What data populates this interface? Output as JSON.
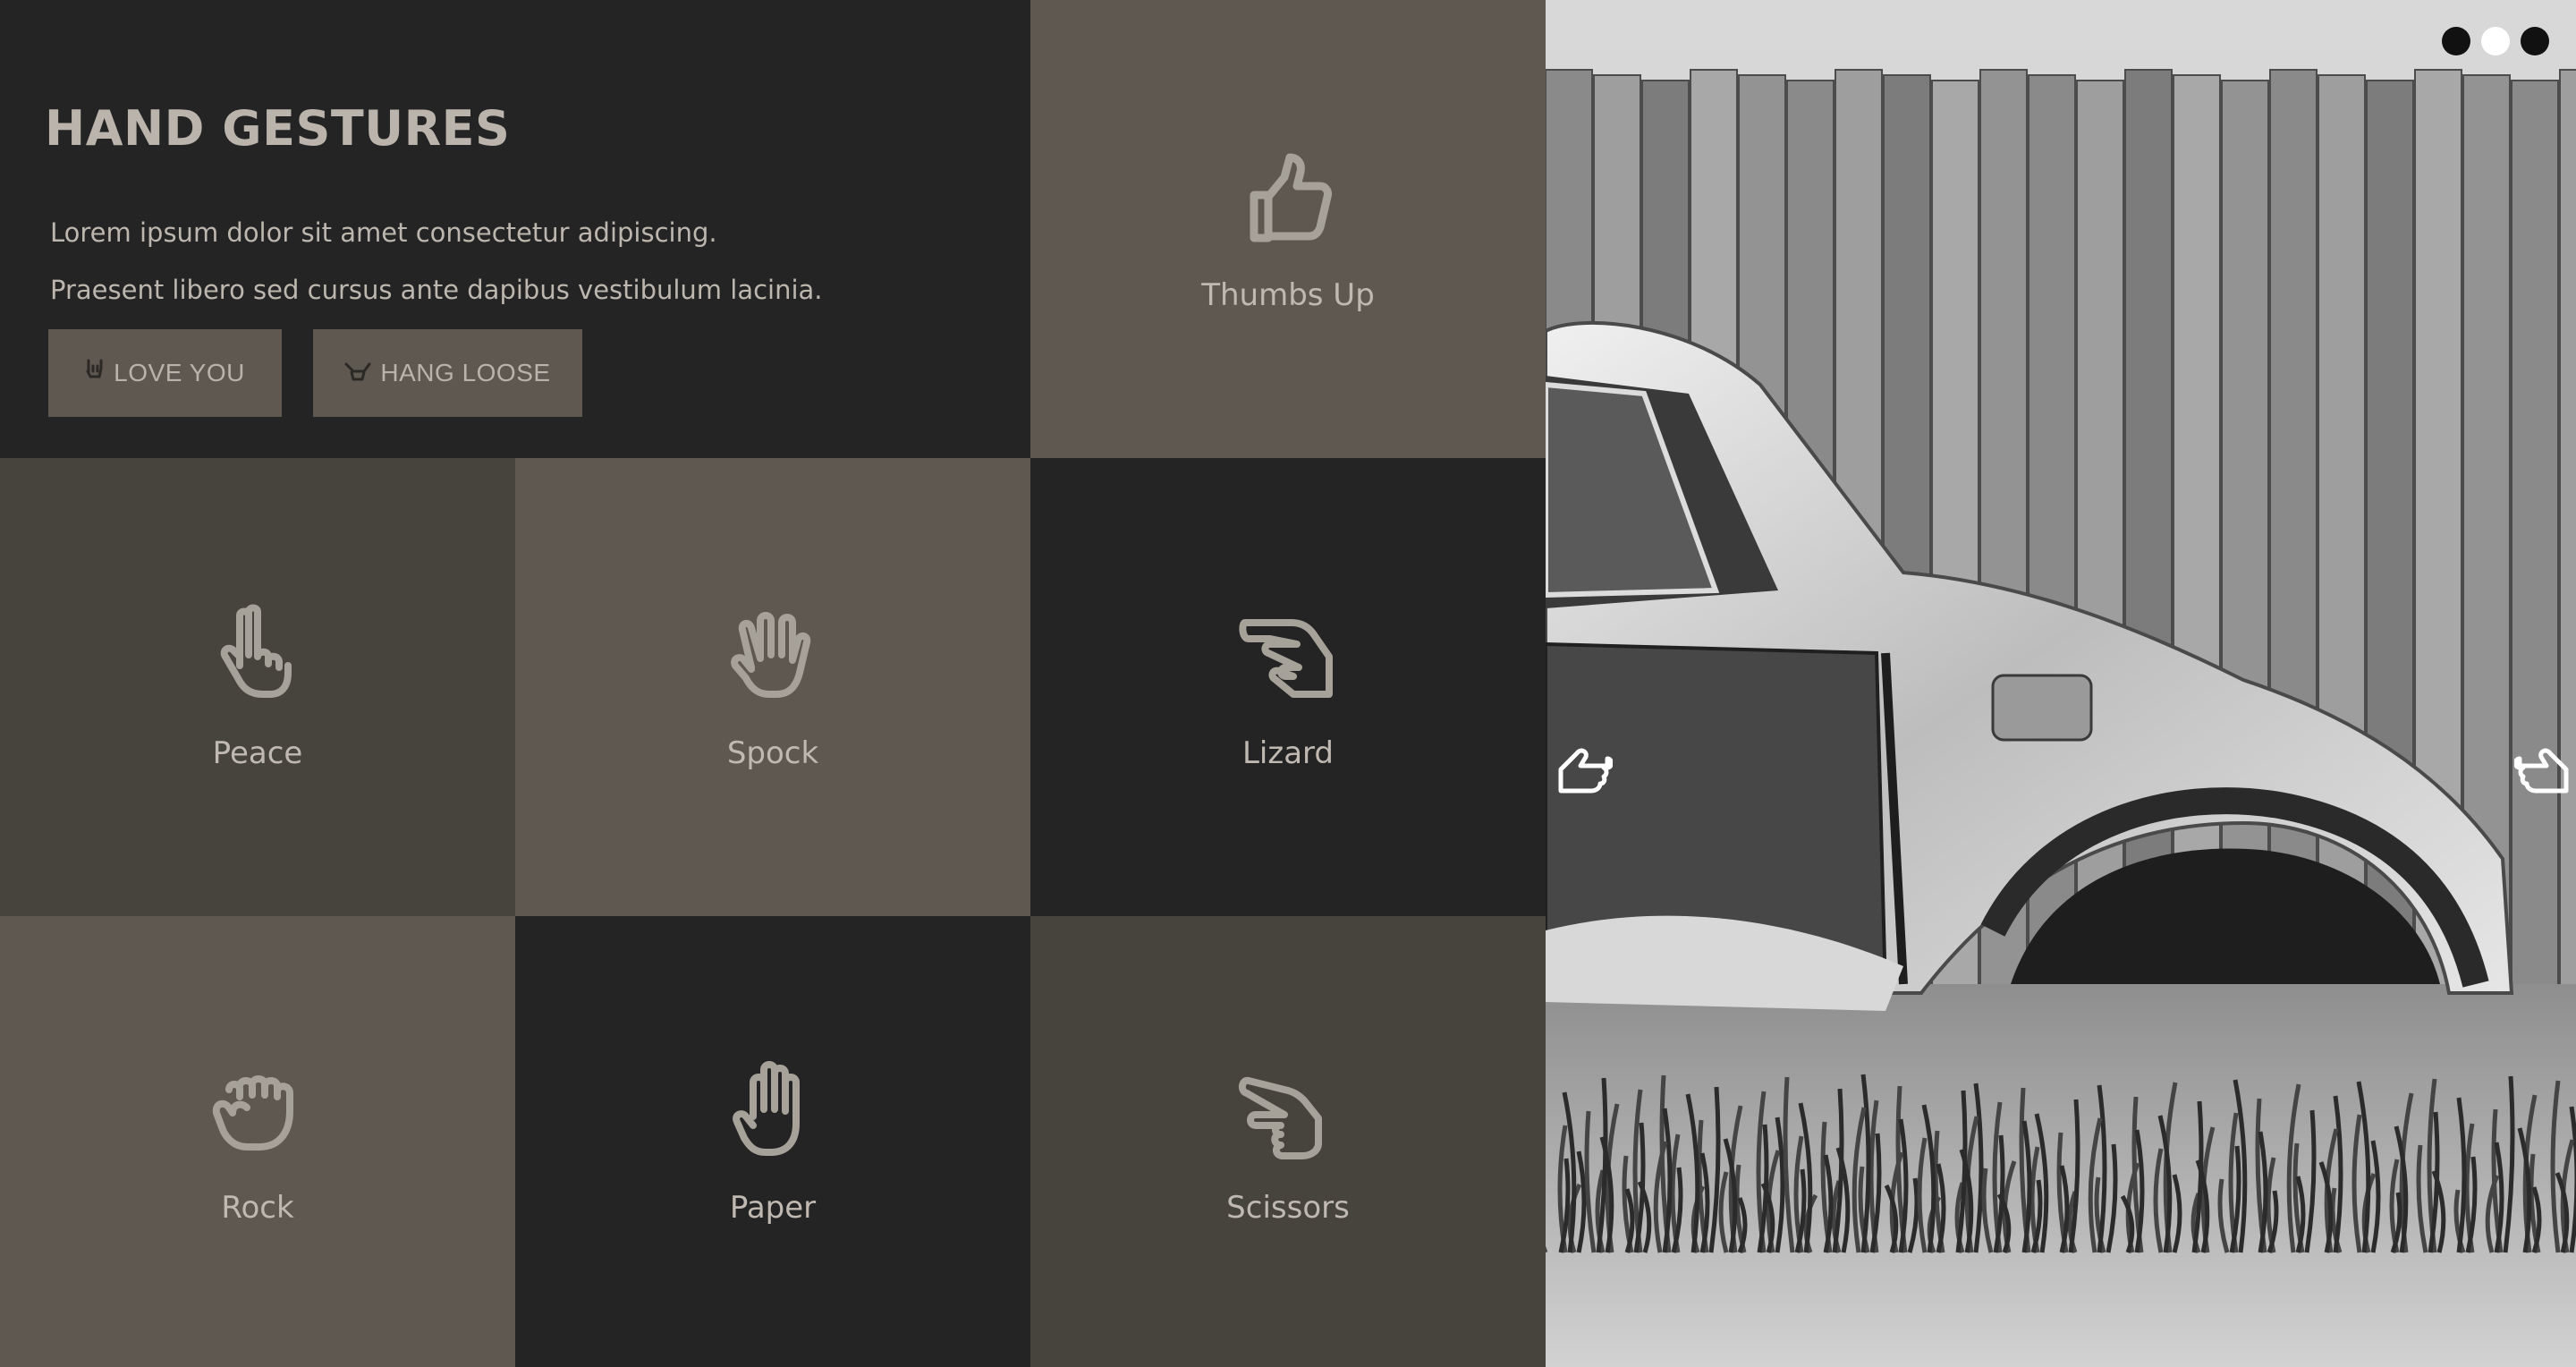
{
  "intro": {
    "title": "HAND GESTURES",
    "paragraphs": [
      "Lorem ipsum dolor sit amet consectetur adipiscing.",
      "Praesent libero sed cursus ante dapibus vestibulum lacinia."
    ],
    "buttons": [
      {
        "label": "LOVE YOU",
        "icon": "love-you-hand-icon"
      },
      {
        "label": "HANG LOOSE",
        "icon": "hang-loose-hand-icon"
      }
    ]
  },
  "tiles": [
    {
      "label": "Thumbs Up",
      "icon": "thumbs-up-icon"
    },
    {
      "label": "Peace",
      "icon": "peace-hand-icon"
    },
    {
      "label": "Spock",
      "icon": "spock-hand-icon"
    },
    {
      "label": "Lizard",
      "icon": "lizard-hand-icon"
    },
    {
      "label": "Rock",
      "icon": "rock-fist-icon"
    },
    {
      "label": "Paper",
      "icon": "paper-hand-icon"
    },
    {
      "label": "Scissors",
      "icon": "scissors-hand-icon"
    }
  ],
  "slider": {
    "image": "black-and-white photo of a wrecked car beside a wooden fence",
    "slide_count": 3,
    "active_slide": 2,
    "prev_icon": "pointing-left-hand-icon",
    "next_icon": "pointing-right-hand-icon"
  },
  "colors": {
    "dark": "#242424",
    "olive": "#47443d",
    "taupe": "#5f5851",
    "text": "#bfb9b1"
  }
}
